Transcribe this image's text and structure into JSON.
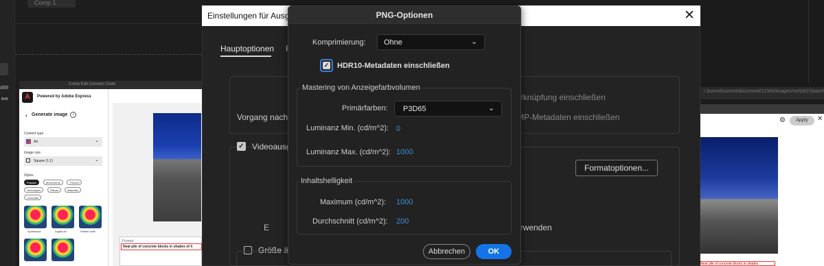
{
  "background": {
    "comp_tab": "Comp 1",
    "left_panel_text": "ate",
    "left_panel_icon": "⚯",
    "top_nav": "Comp  Edit  Connect  Code",
    "right_url": "i Sonnet/sonnet/document/12345/images/nsr5d/2/Search"
  },
  "express": {
    "powered_by": "Powered by Adobe Express",
    "back": "‹",
    "generate_title": "Generate image",
    "content_type_label": "Content type",
    "content_type_value": "Art",
    "image_size_label": "Image size",
    "image_size_value": "Square (1:1)",
    "styles_label": "Styles",
    "style_chips": [
      "Popular",
      "Movements",
      "Themes",
      "Techniques",
      "Effects",
      "Materials",
      "Concepts"
    ],
    "thumbnails": [
      "Synthwave",
      "Digital art",
      "Palette knife"
    ],
    "prompt_label": "Prompt",
    "prompt_value": "Neat pile of concrete blocks in shades of li"
  },
  "right_web": {
    "apply_label": "Apply",
    "settings_icon": "⚙",
    "close_icon": "✕",
    "red_text": "Neat pile of concrete blocks in shades"
  },
  "settings_dialog": {
    "title": "Einstellungen für Ausg",
    "close": "✕",
    "tab_main": "Hauptoptionen",
    "tab_other": "F",
    "vorgang": "Vorgang nach c",
    "link_right": "verknüpfung einschließen",
    "xmp_right": "XMP-Metadaten einschließen",
    "video_label": "Videoausg",
    "format_button": "Formatoptionen...",
    "e_text": "E",
    "verwenden": "verwenden",
    "size_label": "Größe är"
  },
  "png_dialog": {
    "title": "PNG-Optionen",
    "compression_label": "Komprimierung:",
    "compression_value": "Ohne",
    "hdr_label": "HDR10-Metadaten einschließen",
    "hdr_checked": true,
    "mastering_title": "Mastering von Anzeigefarbvolumen",
    "primaries_label": "Primärfarben:",
    "primaries_value": "P3D65",
    "lum_min_label": "Luminanz Min. (cd/m^2):",
    "lum_min_value": "0",
    "lum_max_label": "Luminanz Max. (cd/m^2):",
    "lum_max_value": "1000",
    "content_title": "Inhaltshelligkeit",
    "maximum_label": "Maximum (cd/m^2):",
    "maximum_value": "1000",
    "average_label": "Durchschnitt (cd/m^2):",
    "average_value": "200",
    "cancel_label": "Abbrechen",
    "ok_label": "OK"
  },
  "colors": {
    "accent_blue": "#1473e6",
    "value_blue": "#3b8fe0",
    "focus_ring": "#3a7fd8"
  }
}
